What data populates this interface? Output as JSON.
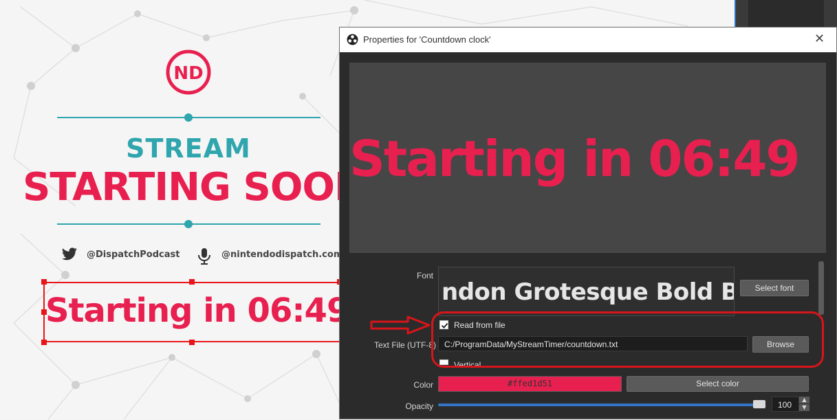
{
  "background": {
    "stream_label": "STREAM",
    "starting_soon_label": "STARTING SOON",
    "twitter_handle": "@DispatchPodcast",
    "website": "@nintendodispatch.com",
    "countdown_text": "Starting in 06:49",
    "logo_text": "ND",
    "colors": {
      "accent_pink": "#e8204f",
      "accent_teal": "#2fa5ad",
      "selection_red": "#e8151a"
    }
  },
  "dialog": {
    "title": "Properties for 'Countdown clock'",
    "close_icon": "close-icon",
    "app_icon": "obs-icon",
    "preview_text": "Starting in 06:49",
    "font": {
      "label": "Font",
      "preview": "ndon Grotesque Bold B",
      "select_button": "Select font"
    },
    "read_from_file": {
      "label": "Read from file",
      "checked": true
    },
    "text_file": {
      "label": "Text File (UTF-8)",
      "value": "C:/ProgramData/MyStreamTimer/countdown.txt",
      "browse_button": "Browse"
    },
    "vertical": {
      "label": "Vertical",
      "checked": false
    },
    "color": {
      "label": "Color",
      "value": "#ffed1d51",
      "select_button": "Select color"
    },
    "opacity": {
      "label": "Opacity",
      "value": "100",
      "level": 1.0
    }
  }
}
